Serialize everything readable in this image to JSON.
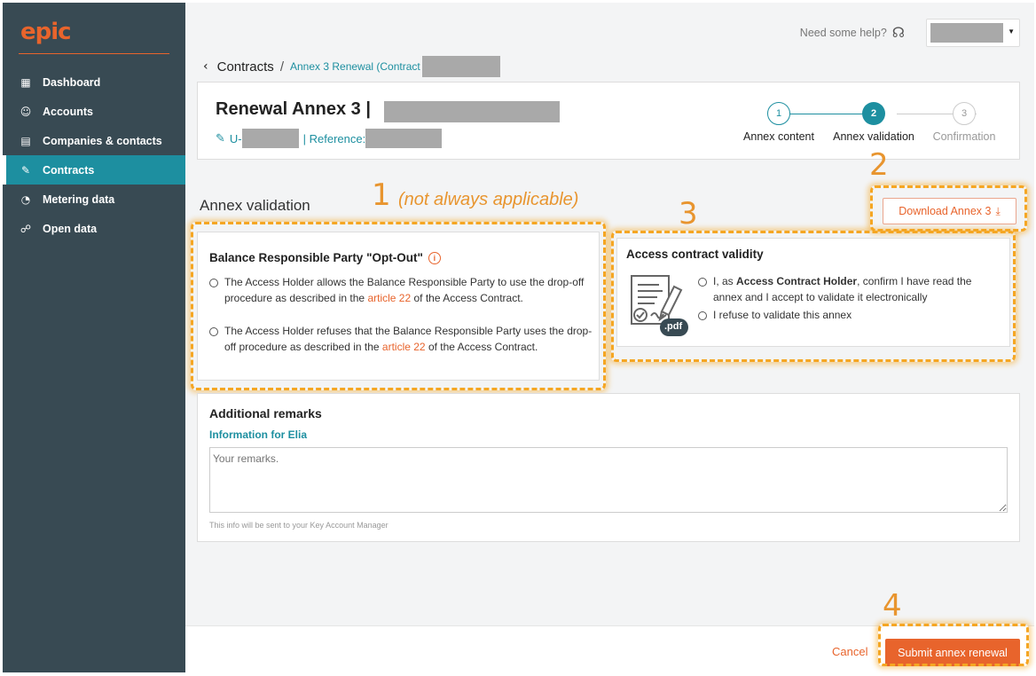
{
  "app": {
    "logo": "epic"
  },
  "sidebar": {
    "items": [
      {
        "label": "Dashboard",
        "icon": "dashboard-icon"
      },
      {
        "label": "Accounts",
        "icon": "accounts-icon"
      },
      {
        "label": "Companies & contacts",
        "icon": "companies-icon"
      },
      {
        "label": "Contracts",
        "icon": "contracts-icon",
        "active": true
      },
      {
        "label": "Metering data",
        "icon": "metering-icon"
      },
      {
        "label": "Open data",
        "icon": "open-data-icon"
      }
    ]
  },
  "topbar": {
    "help_text": "Need some help?"
  },
  "breadcrumb": {
    "parent": "Contracts",
    "separator": "/",
    "current": "Annex 3 Renewal (Contract"
  },
  "header": {
    "title": "Renewal Annex 3 |",
    "id_prefix": "U-",
    "reference_label": "| Reference:"
  },
  "stepper": {
    "steps": [
      {
        "number": "1",
        "label": "Annex content",
        "state": "done"
      },
      {
        "number": "2",
        "label": "Annex validation",
        "state": "active"
      },
      {
        "number": "3",
        "label": "Confirmation",
        "state": "pending"
      }
    ]
  },
  "page": {
    "section_title": "Annex validation",
    "download_label": "Download Annex 3"
  },
  "annotations": {
    "n1": "1",
    "n1_note": "(not always applicable)",
    "n2": "2",
    "n3": "3",
    "n4": "4"
  },
  "opt_out": {
    "title": "Balance Responsible Party \"Opt-Out\"",
    "option1_text": "The Access Holder allows the Balance Responsible Party to use the drop-off procedure as described in the",
    "option2_text": "The Access Holder refuses that the Balance Responsible Party uses the drop-off procedure as described in the",
    "link_text": "article 22",
    "suffix": "of the Access Contract."
  },
  "validity": {
    "title": "Access contract validity",
    "option1_pre": "I, as",
    "option1_bold": "Access Contract Holder",
    "option1_post": ", confirm I have read the annex and I accept to validate it electronically",
    "option2": "I refuse to validate this annex",
    "pdf_badge": ".pdf"
  },
  "remarks": {
    "title": "Additional remarks",
    "subtitle": "Information for Elia",
    "placeholder": "Your remarks.",
    "note": "This info will be sent to your Key Account Manager"
  },
  "footer": {
    "cancel": "Cancel",
    "submit": "Submit annex renewal"
  },
  "colors": {
    "brand_orange": "#e8642c",
    "teal": "#1d8fa0",
    "sidebar_bg": "#384a53",
    "highlight": "#f5a623"
  }
}
